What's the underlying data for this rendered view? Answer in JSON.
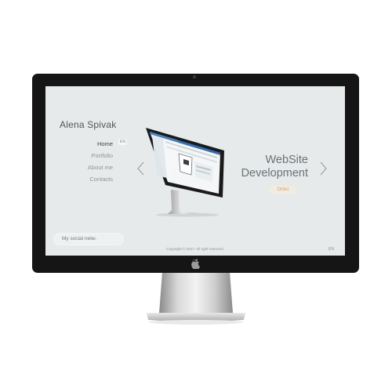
{
  "site": {
    "owner_name": "Alena Spivak",
    "nav": [
      {
        "label": "Home",
        "active": true
      },
      {
        "label": "Portfolio",
        "active": false
      },
      {
        "label": "About me",
        "active": false
      },
      {
        "label": "Contacts",
        "active": false
      }
    ],
    "nav_badge": "EN",
    "social_button": "My social netw.",
    "hero": {
      "title_line1": "WebSite",
      "title_line2": "Development",
      "order_button": "Order"
    },
    "copyright": "Copyright © 2017. All right reserved.",
    "language": "EN"
  },
  "colors": {
    "screen_bg": "#e6eaeb",
    "accent_order": "#d8a46a",
    "bezel": "#151515"
  },
  "icons": {
    "prev": "chevron-left-icon",
    "next": "chevron-right-icon",
    "brand": "apple-logo-icon"
  }
}
